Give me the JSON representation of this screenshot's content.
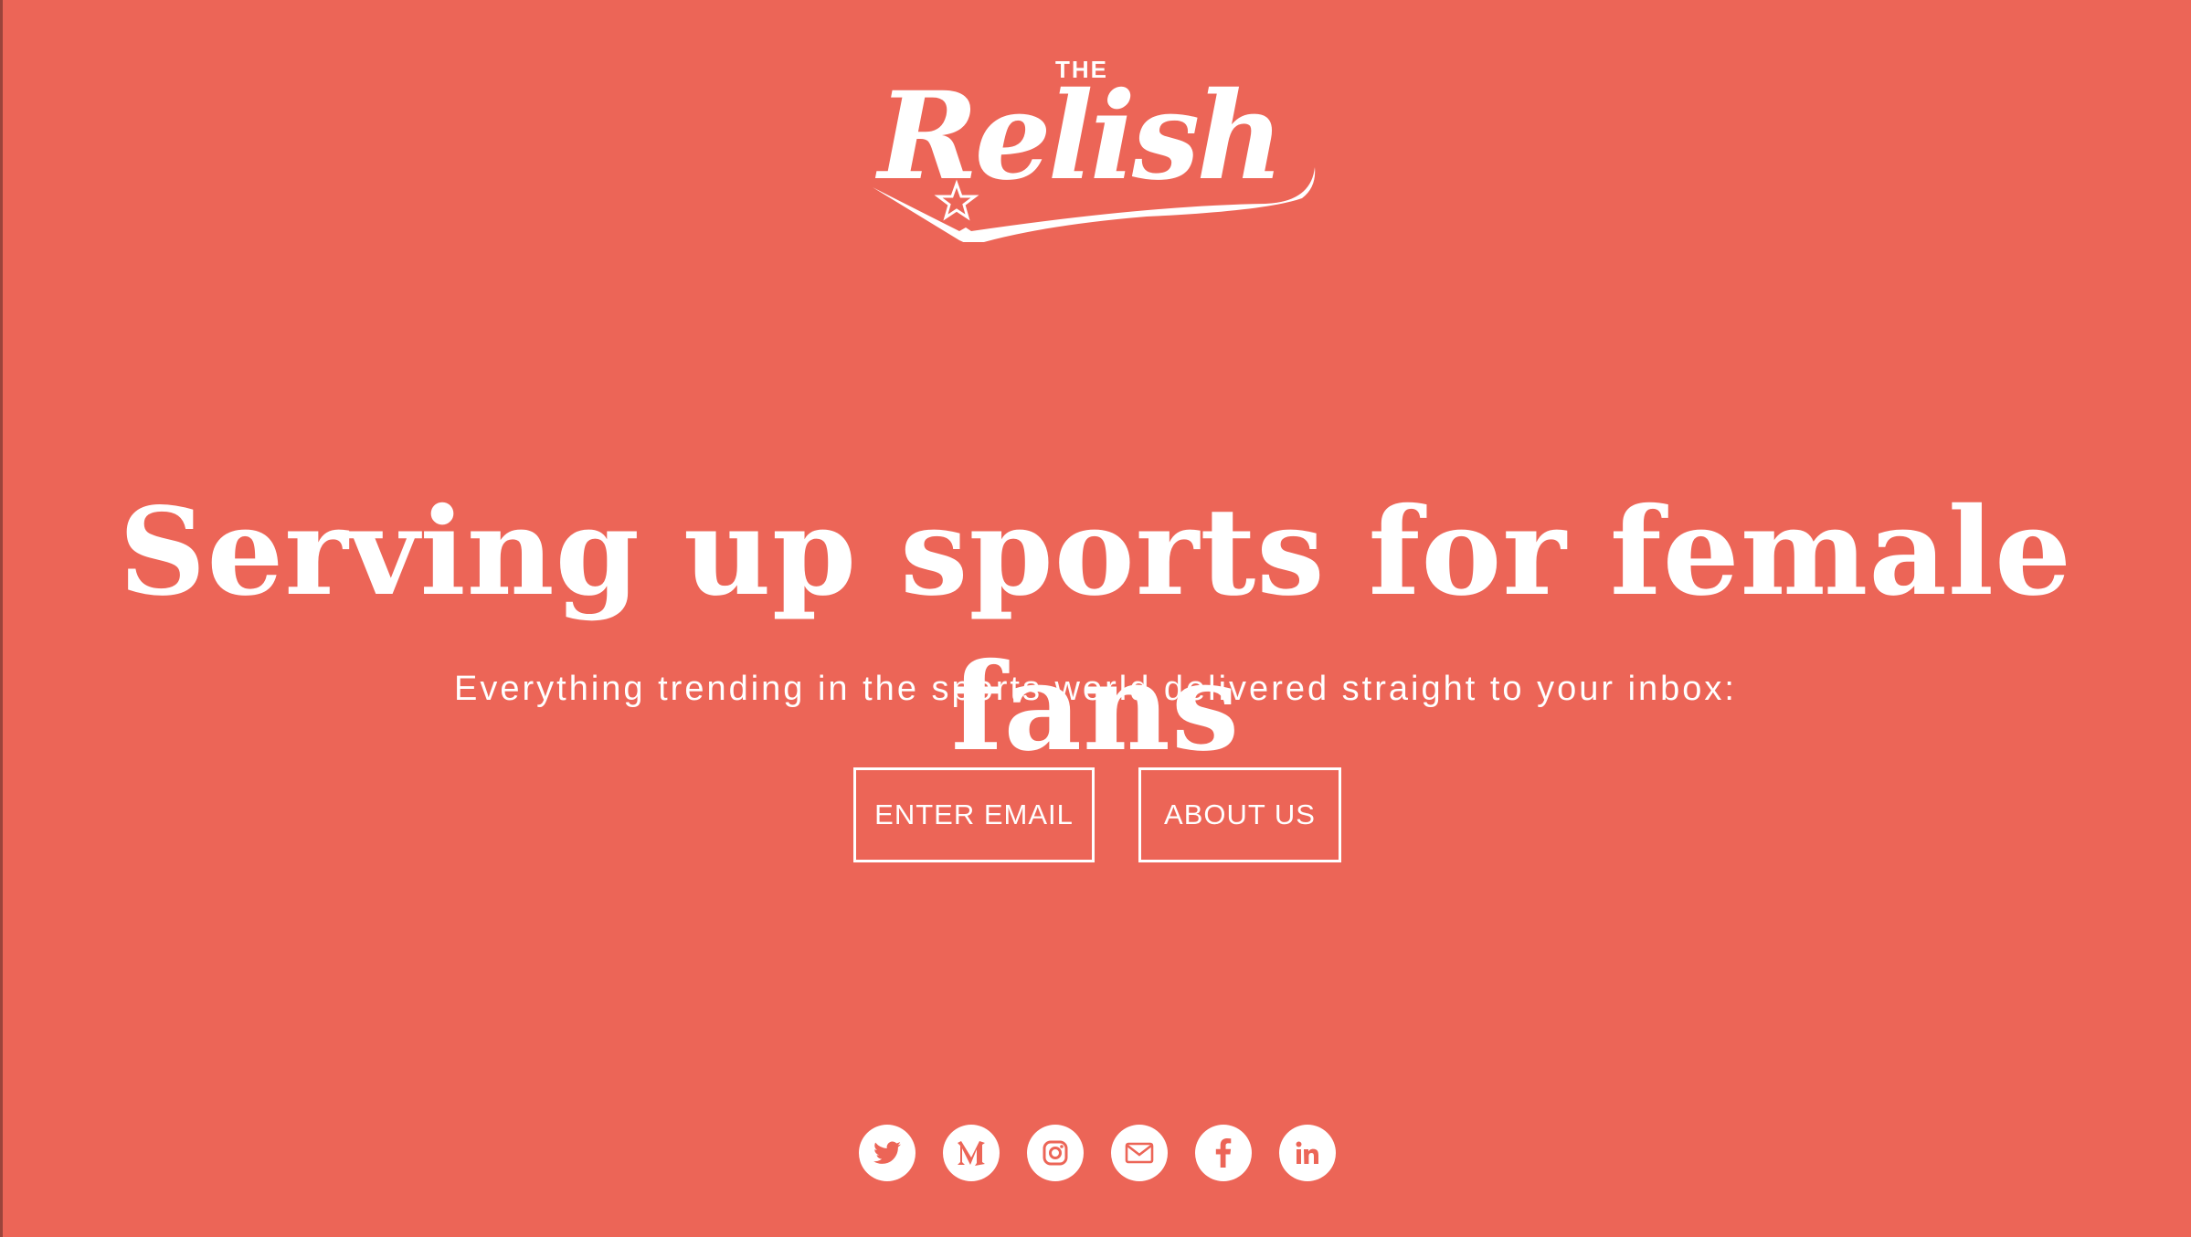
{
  "brand": {
    "logo_text": "THE Relish",
    "accent_color": "#ec6557",
    "foreground_color": "#ffffff"
  },
  "hero": {
    "headline": "Serving up sports for female fans",
    "subheadline": "Everything trending in the sports world delivered straight to your inbox:"
  },
  "actions": {
    "enter_email_label": "ENTER EMAIL",
    "about_us_label": "ABOUT US"
  },
  "social": [
    {
      "icon": "twitter-icon"
    },
    {
      "icon": "medium-icon"
    },
    {
      "icon": "instagram-icon"
    },
    {
      "icon": "email-icon"
    },
    {
      "icon": "facebook-icon"
    },
    {
      "icon": "linkedin-icon"
    }
  ]
}
